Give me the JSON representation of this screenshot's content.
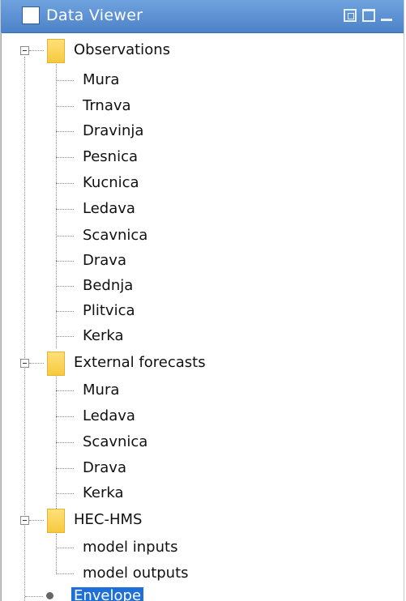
{
  "window": {
    "title": "Data Viewer"
  },
  "tree": {
    "groups": [
      {
        "label": "Observations",
        "children": [
          "Mura",
          "Trnava",
          "Dravinja",
          "Pesnica",
          "Kucnica",
          "Ledava",
          "Scavnica",
          "Drava",
          "Bednja",
          "Plitvica",
          "Kerka"
        ]
      },
      {
        "label": "External forecasts",
        "children": [
          "Mura",
          "Ledava",
          "Scavnica",
          "Drava",
          "Kerka"
        ]
      },
      {
        "label": "HEC-HMS",
        "children": [
          "model inputs",
          "model outputs"
        ]
      }
    ],
    "selected_item": {
      "label": "Envelope"
    }
  }
}
